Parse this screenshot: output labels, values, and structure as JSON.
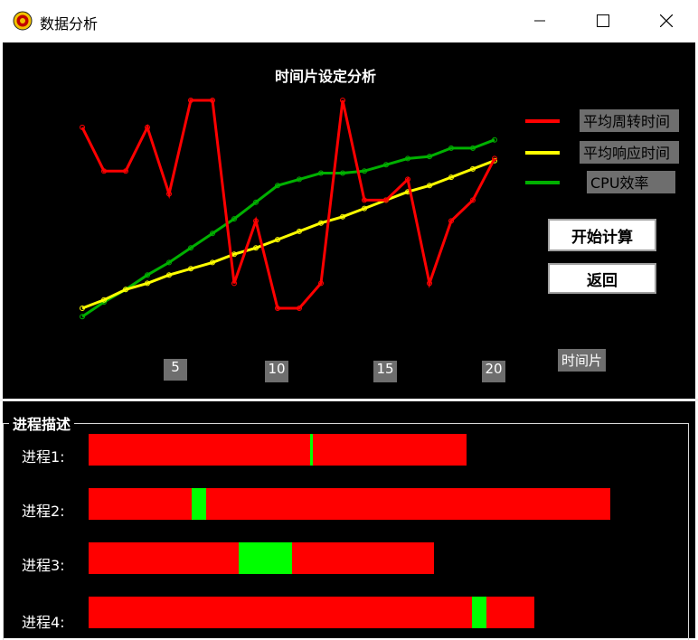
{
  "window": {
    "title": "数据分析"
  },
  "chart_data": {
    "type": "line",
    "title": "时间片设定分析",
    "x": [
      1,
      2,
      3,
      4,
      5,
      6,
      7,
      8,
      9,
      10,
      11,
      12,
      13,
      14,
      15,
      16,
      17,
      18,
      19,
      20
    ],
    "xticks": [
      "5",
      "10",
      "15",
      "20"
    ],
    "xlabel": "时间片",
    "series": [
      {
        "name": "平均周转时间",
        "color": "#ff0000",
        "values": [
          0.87,
          0.66,
          0.66,
          0.87,
          0.55,
          1.0,
          1.0,
          0.12,
          0.42,
          0.0,
          0.0,
          0.12,
          1.0,
          0.52,
          0.52,
          0.62,
          0.12,
          0.42,
          0.52,
          0.72
        ]
      },
      {
        "name": "平均响应时间",
        "color": "#ffff00",
        "values": [
          0.0,
          0.04,
          0.09,
          0.12,
          0.16,
          0.19,
          0.22,
          0.26,
          0.29,
          0.33,
          0.37,
          0.41,
          0.44,
          0.48,
          0.52,
          0.56,
          0.59,
          0.63,
          0.67,
          0.71
        ]
      },
      {
        "name": "CPU效率",
        "color": "#00b000",
        "values": [
          -0.04,
          0.03,
          0.09,
          0.16,
          0.22,
          0.29,
          0.36,
          0.43,
          0.51,
          0.59,
          0.62,
          0.65,
          0.65,
          0.66,
          0.69,
          0.72,
          0.73,
          0.77,
          0.77,
          0.81
        ]
      }
    ],
    "grid": false,
    "legend": "right"
  },
  "buttons": {
    "start": "开始计算",
    "back": "返回"
  },
  "process_section": {
    "title": "进程描述"
  },
  "processes": [
    {
      "label": "进程1:",
      "total": 418,
      "green_start": 245,
      "green_len": 3
    },
    {
      "label": "进程2:",
      "total": 577,
      "green_start": 114,
      "green_len": 16
    },
    {
      "label": "进程3:",
      "total": 382,
      "green_start": 166,
      "green_len": 59
    },
    {
      "label": "进程4:",
      "total": 493,
      "green_start": 424,
      "green_len": 16
    }
  ]
}
